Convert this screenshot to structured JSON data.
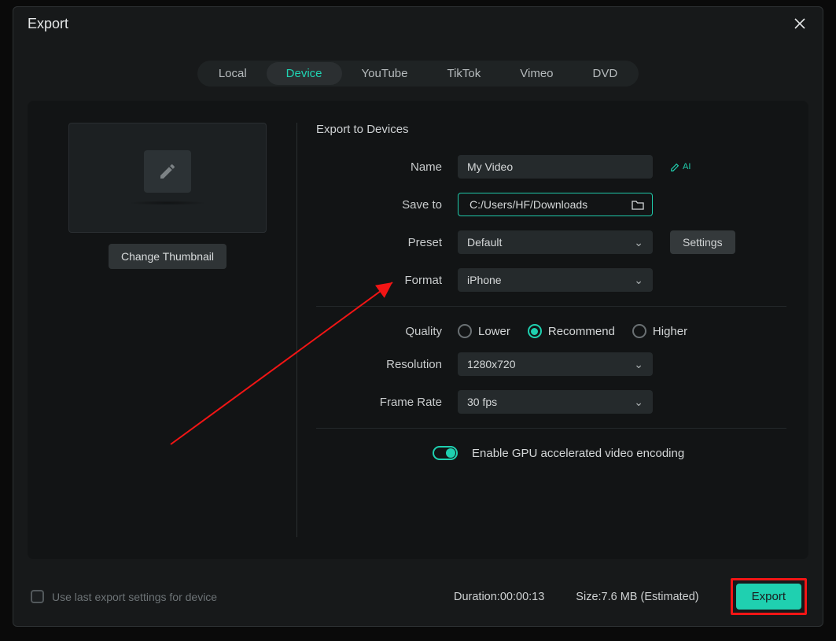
{
  "dialog": {
    "title": "Export"
  },
  "tabs": {
    "local": "Local",
    "device": "Device",
    "youtube": "YouTube",
    "tiktok": "TikTok",
    "vimeo": "Vimeo",
    "dvd": "DVD"
  },
  "thumbnail": {
    "change_label": "Change Thumbnail"
  },
  "form": {
    "section_title": "Export to Devices",
    "name_label": "Name",
    "name_value": "My Video",
    "saveto_label": "Save to",
    "saveto_value": "C:/Users/HF/Downloads",
    "preset_label": "Preset",
    "preset_value": "Default",
    "settings_btn": "Settings",
    "format_label": "Format",
    "format_value": "iPhone",
    "quality_label": "Quality",
    "quality_lower": "Lower",
    "quality_recommend": "Recommend",
    "quality_higher": "Higher",
    "resolution_label": "Resolution",
    "resolution_value": "1280x720",
    "framerate_label": "Frame Rate",
    "framerate_value": "30 fps",
    "gpu_label": "Enable GPU accelerated video encoding"
  },
  "footer": {
    "use_last": "Use last export settings for device",
    "duration_label": "Duration:",
    "duration_value": "00:00:13",
    "size_label": "Size:",
    "size_value": "7.6 MB (Estimated)",
    "export_btn": "Export"
  },
  "accent": "#1fd0b0"
}
